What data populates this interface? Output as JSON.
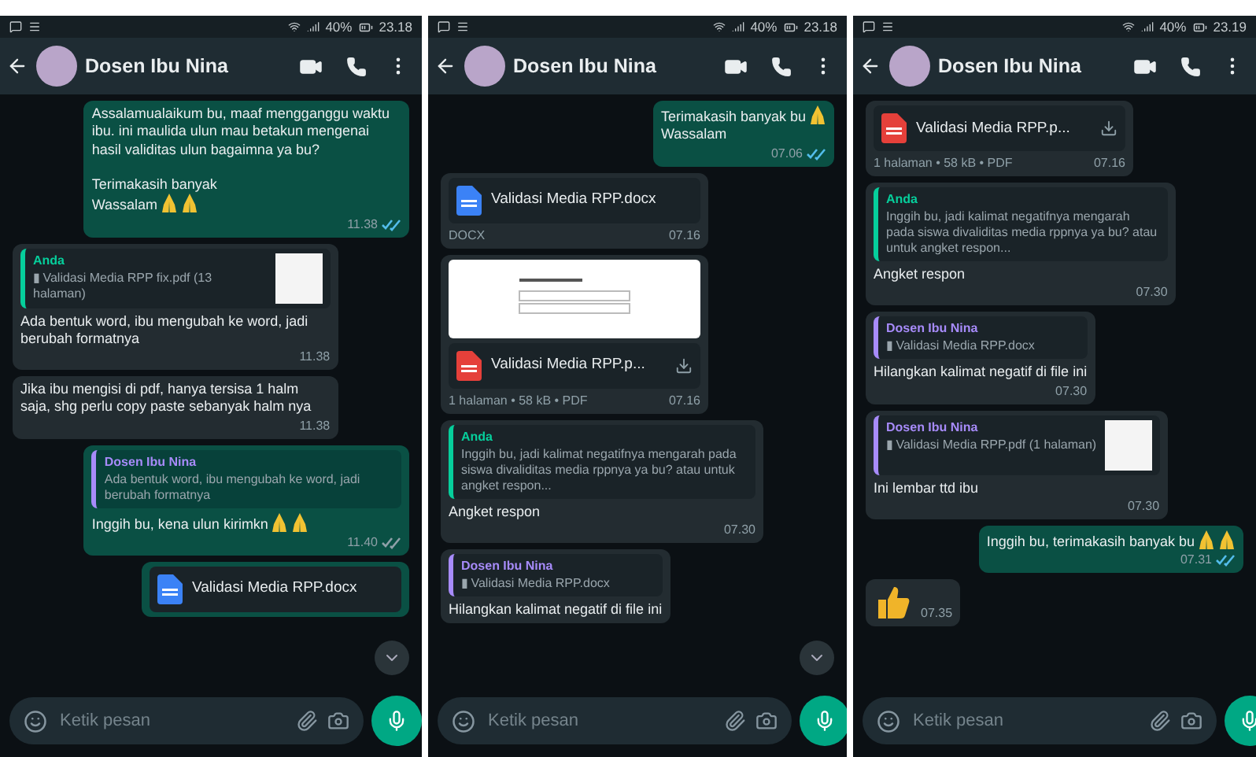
{
  "panels": [
    {
      "status_bar": {
        "battery": "40%",
        "time": "23.18"
      },
      "header": {
        "title": "Dosen Ibu Nina"
      },
      "scroll_down_button": true,
      "input": {
        "placeholder": "Ketik pesan"
      },
      "messages": [
        {
          "outgoing": true,
          "kind": "text",
          "lines": [
            {
              "text": "Assalamualaikum bu, maaf mengganggu waktu ibu. ini maulida ulun mau betakun mengenai hasil validitas ulun bagaimna ya bu?\n\nTerimakasih banyak"
            },
            {
              "text": "Wassalam",
              "emojis": [
                {
                  "kind": "pray"
                },
                {
                  "kind": "pray"
                }
              ]
            }
          ],
          "time": "11.38",
          "read": true
        },
        {
          "outgoing": false,
          "kind": "text",
          "quote": {
            "author": "Anda",
            "color": "#06cf9c",
            "text": "▮ Validasi Media RPP fix.pdf (13 halaman)",
            "thumbnail": true
          },
          "lines": [
            {
              "text": "Ada bentuk word, ibu mengubah ke word, jadi berubah formatnya"
            }
          ],
          "time": "11.38"
        },
        {
          "outgoing": false,
          "kind": "text",
          "lines": [
            {
              "text": "Jika ibu mengisi di pdf, hanya tersisa 1 halm saja, shg perlu copy paste sebanyak halm nya"
            }
          ],
          "time": "11.38"
        },
        {
          "outgoing": true,
          "kind": "text",
          "quote": {
            "author": "Dosen Ibu Nina",
            "color": "#a78bfa",
            "text": "Ada bentuk word, ibu mengubah ke word, jadi berubah formatnya",
            "thumbnail": false
          },
          "lines": [
            {
              "text": "Inggih bu, kena ulun kirimkn",
              "emojis": [
                {
                  "kind": "pray"
                },
                {
                  "kind": "pray"
                }
              ]
            }
          ],
          "time": "11.40",
          "read": false
        },
        {
          "outgoing": true,
          "kind": "document",
          "name": "Validasi Media RPP.docx"
        }
      ]
    },
    {
      "status_bar": {
        "battery": "40%",
        "time": "23.18"
      },
      "header": {
        "title": "Dosen Ibu Nina"
      },
      "scroll_down_button": true,
      "input": {
        "placeholder": "Ketik pesan"
      },
      "messages": [
        {
          "outgoing": true,
          "kind": "text",
          "lines": [
            {
              "text": "Terimakasih banyak bu",
              "emojis": [
                {
                  "kind": "pray"
                }
              ]
            },
            {
              "text": "Wassalam"
            }
          ],
          "time": "07.06",
          "read": true
        },
        {
          "outgoing": false,
          "kind": "document",
          "name": "Validasi Media RPP.docx",
          "meta": "DOCX",
          "time": "07.16"
        },
        {
          "outgoing": false,
          "kind": "pdf",
          "preview": true,
          "name": "Validasi Media RPP.p...",
          "meta": "1 halaman • 58 kB • PDF",
          "time": "07.16"
        },
        {
          "outgoing": false,
          "kind": "text",
          "quote": {
            "author": "Anda",
            "color": "#06cf9c",
            "text": "Inggih bu, jadi kalimat negatifnya mengarah pada siswa divaliditas media rppnya ya bu? atau untuk angket respon...",
            "thumbnail": false
          },
          "lines": [
            {
              "text": "Angket respon"
            }
          ],
          "time": "07.30"
        },
        {
          "outgoing": false,
          "kind": "text",
          "quote": {
            "author": "Dosen Ibu Nina",
            "color": "#a78bfa",
            "text": "▮ Validasi Media RPP.docx",
            "thumbnail": false
          },
          "lines": [
            {
              "text": "Hilangkan kalimat negatif di file ini"
            }
          ]
        }
      ]
    },
    {
      "status_bar": {
        "battery": "40%",
        "time": "23.19"
      },
      "header": {
        "title": "Dosen Ibu Nina"
      },
      "input": {
        "placeholder": "Ketik pesan"
      },
      "messages": [
        {
          "outgoing": false,
          "kind": "pdf",
          "name": "Validasi Media RPP.p...",
          "meta": "1 halaman • 58 kB • PDF",
          "time": "07.16"
        },
        {
          "outgoing": false,
          "kind": "text",
          "quote": {
            "author": "Anda",
            "color": "#06cf9c",
            "text": "Inggih bu, jadi kalimat negatifnya mengarah pada siswa divaliditas media rppnya ya bu? atau untuk angket respon...",
            "thumbnail": false
          },
          "lines": [
            {
              "text": "Angket respon"
            }
          ],
          "time": "07.30"
        },
        {
          "outgoing": false,
          "kind": "text",
          "quote": {
            "author": "Dosen Ibu Nina",
            "color": "#a78bfa",
            "text": "▮ Validasi Media RPP.docx",
            "thumbnail": false
          },
          "lines": [
            {
              "text": "Hilangkan kalimat negatif di file ini"
            }
          ],
          "time": "07.30"
        },
        {
          "outgoing": false,
          "kind": "text",
          "quote": {
            "author": "Dosen Ibu Nina",
            "color": "#a78bfa",
            "text": "▮ Validasi Media RPP.pdf (1 halaman)",
            "thumbnail": true
          },
          "lines": [
            {
              "text": "Ini lembar ttd ibu"
            }
          ],
          "time": "07.30"
        },
        {
          "outgoing": true,
          "kind": "text",
          "lines": [
            {
              "text": "Inggih bu, terimakasih banyak bu",
              "emojis": [
                {
                  "kind": "pray"
                },
                {
                  "kind": "pray"
                }
              ]
            }
          ],
          "time": "07.31",
          "read": true
        },
        {
          "outgoing": false,
          "kind": "emoji",
          "emojis": [
            {
              "kind": "thumbs-up"
            }
          ],
          "time": "07.35"
        }
      ]
    }
  ]
}
